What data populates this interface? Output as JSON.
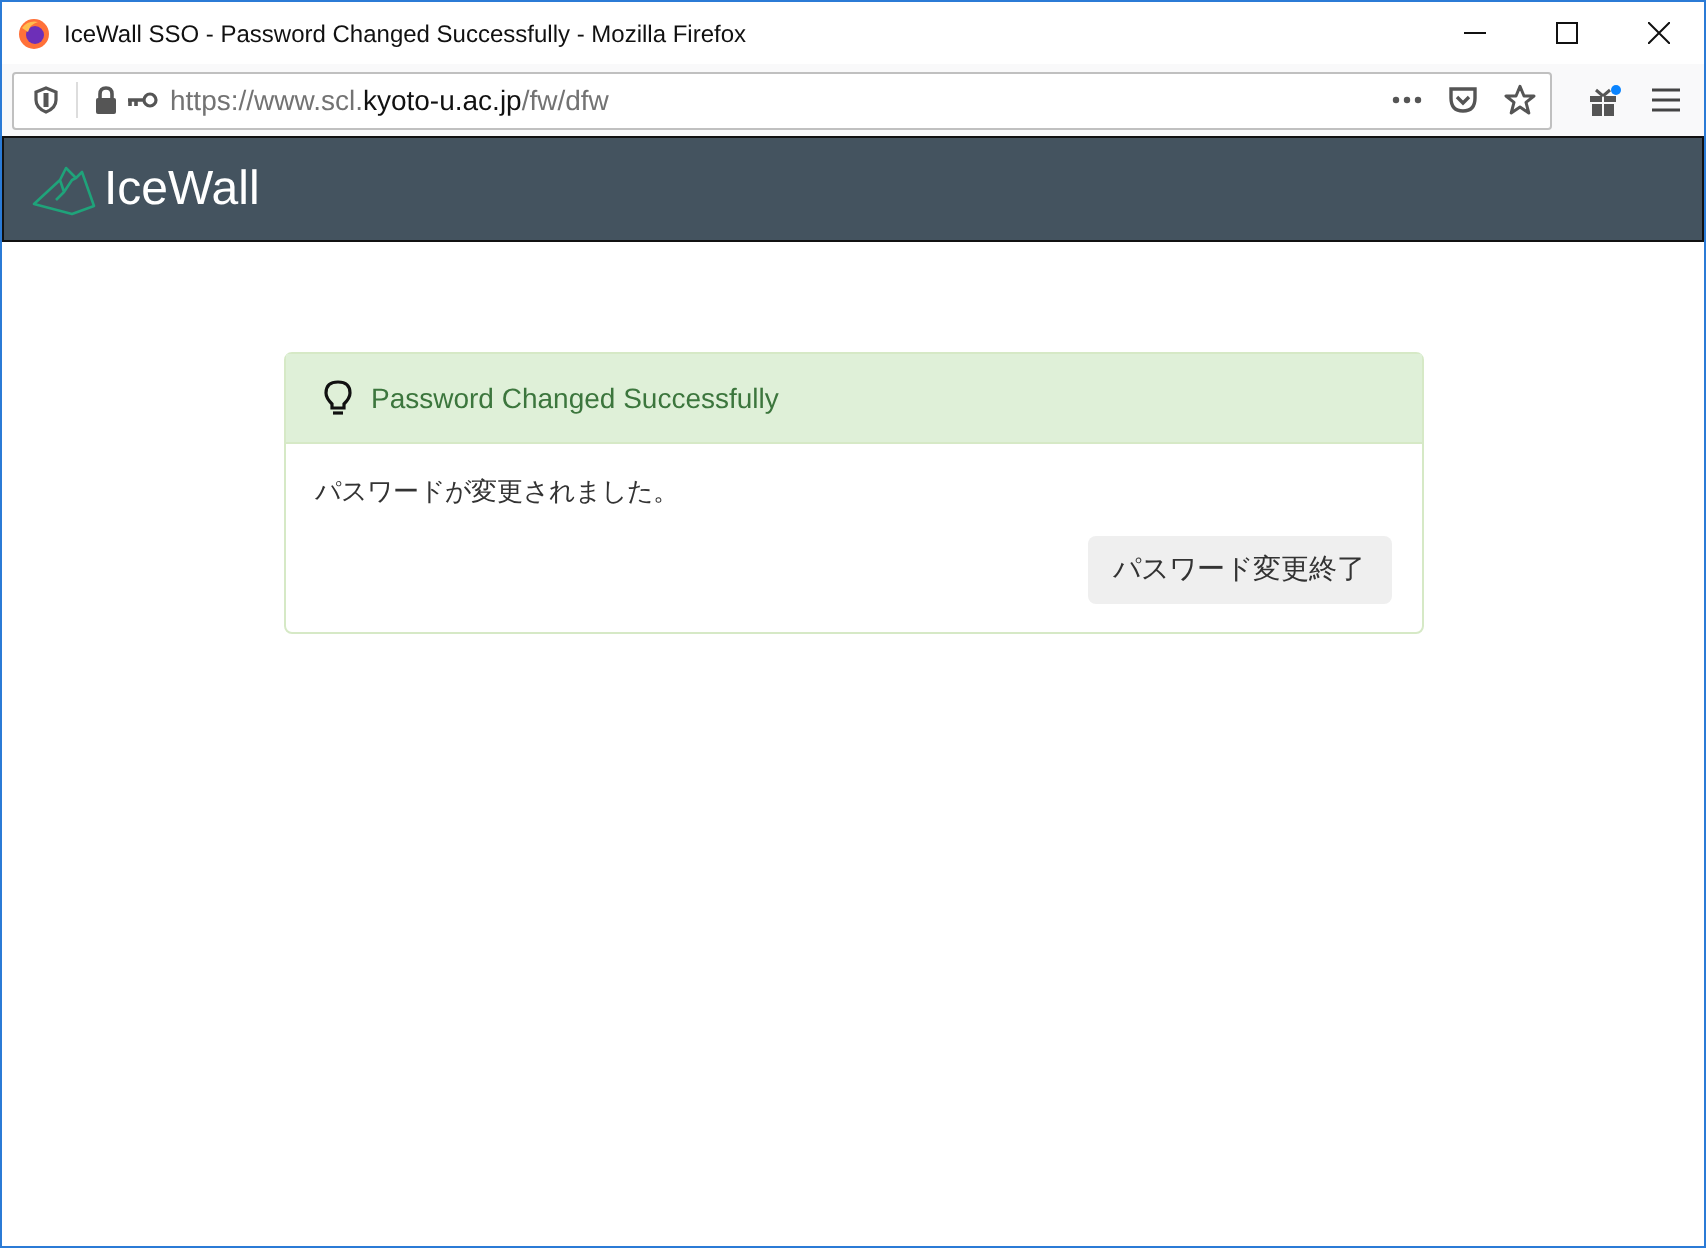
{
  "window": {
    "title": "IceWall SSO - Password Changed Successfully - Mozilla Firefox"
  },
  "url": {
    "prefix": "https://www.scl.",
    "domain": "kyoto-u.ac.jp",
    "suffix": "/fw/dfw"
  },
  "header": {
    "logo_text": "IceWall"
  },
  "alert": {
    "title": "Password Changed Successfully",
    "message": "パスワードが変更されました。",
    "button": "パスワード変更終了"
  }
}
